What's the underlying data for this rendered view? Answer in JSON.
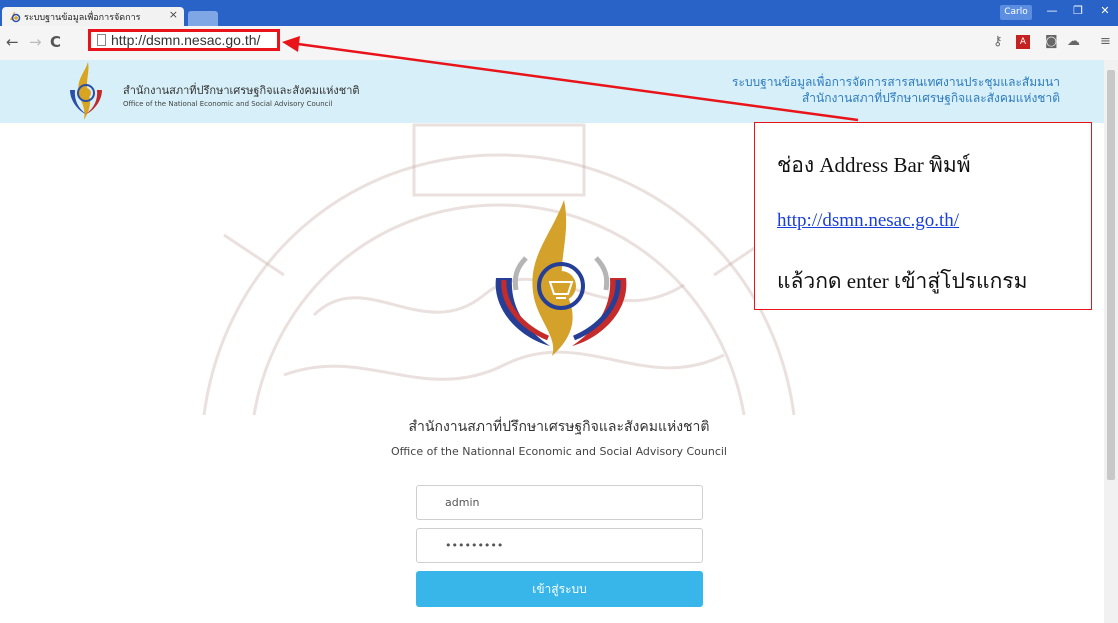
{
  "browser": {
    "tab_title": "ระบบฐานข้อมูลเพื่อการจัดการ",
    "tab_close": "×",
    "user_badge": "Carlo",
    "url": "http://dsmn.nesac.go.th/",
    "pdf_icon_text": "A"
  },
  "header": {
    "org_name_th": "สำนักงานสภาที่ปรึกษาเศรษฐกิจและสังคมแห่งชาติ",
    "org_name_en": "Office of the National Economic and Social Advisory Council",
    "system_title_line1": "ระบบฐานข้อมูลเพื่อการจัดการสารสนเทศงานประชุมและสัมมนา",
    "system_title_line2": "สำนักงานสภาที่ปรึกษาเศรษฐกิจและสังคมแห่งชาติ"
  },
  "login": {
    "org_name_th": "สำนักงานสภาที่ปรึกษาเศรษฐกิจและสังคมแห่งชาติ",
    "org_name_en": "Office of the Nationnal Economic and Social Advisory Council",
    "username": "admin",
    "password": "•••••••••",
    "submit_label": "เข้าสู่ระบบ"
  },
  "annotation": {
    "line1": "ช่อง Address Bar พิมพ์",
    "line2": "http://dsmn.nesac.go.th/",
    "line3": "แล้วกด enter เข้าสู่โปรแกรม"
  },
  "colors": {
    "annotation_red": "#e8141a",
    "header_bg": "#d7eff8",
    "button_blue": "#38b6ea",
    "title_bar_blue": "#2a63c8"
  }
}
